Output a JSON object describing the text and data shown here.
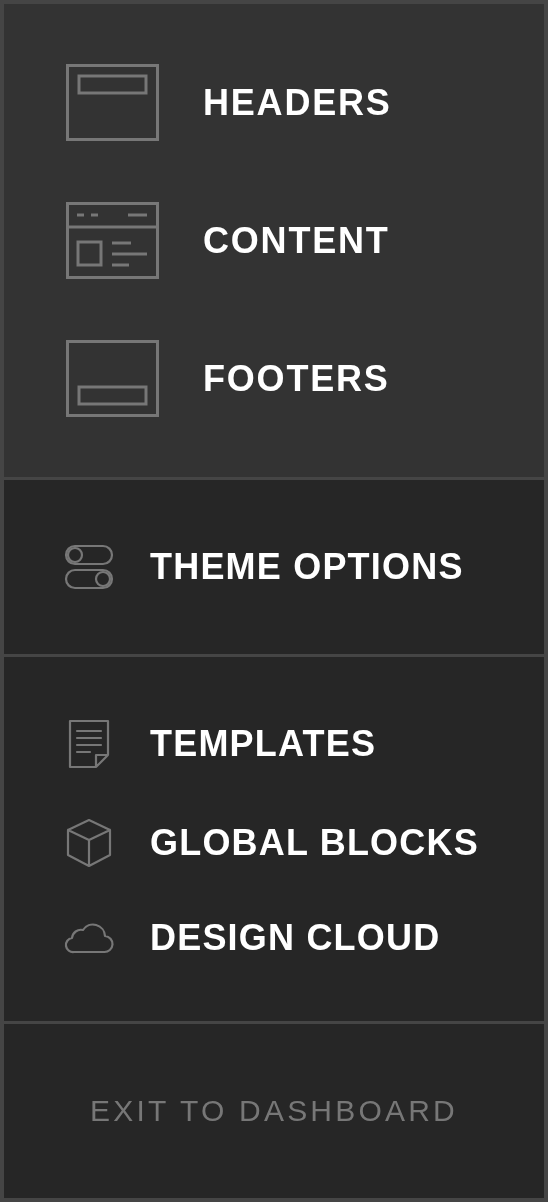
{
  "blocks": [
    {
      "label": "HEADERS",
      "kind": "header"
    },
    {
      "label": "CONTENT",
      "kind": "content"
    },
    {
      "label": "FOOTERS",
      "kind": "footer"
    }
  ],
  "menu_groups": [
    [
      {
        "label": "THEME OPTIONS",
        "kind": "toggles"
      }
    ],
    [
      {
        "label": "TEMPLATES",
        "kind": "document"
      },
      {
        "label": "GLOBAL BLOCKS",
        "kind": "cube"
      },
      {
        "label": "DESIGN CLOUD",
        "kind": "cloud"
      }
    ]
  ],
  "exit": {
    "label": "EXIT TO DASHBOARD"
  }
}
